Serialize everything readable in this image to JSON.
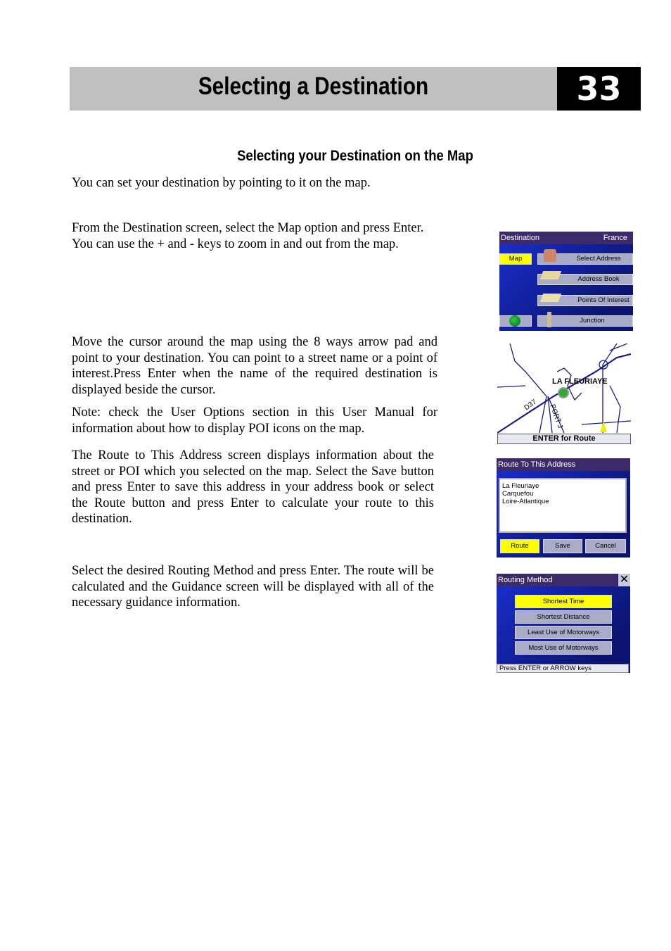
{
  "header": {
    "title": "Selecting a Destination",
    "page_number": "33"
  },
  "section_title": "Selecting your Destination on the Map",
  "paragraphs": [
    "You can set your destination by pointing to it on the map.",
    "From the Destination screen, select the Map option and press Enter. You can use the + and - keys to zoom in and out from the map.",
    "Move the cursor around the map using the 8 ways arrow pad and point to your destination. You can point to a street name or a point of interest.Press Enter when the name of the required destination is displayed beside the cursor.",
    "Note: check the User Options section in this User Manual for information about how to display POI icons on the map.",
    "The Route to This Address screen displays information about the street or POI which you selected on the map. Select the Save button and press Enter to save this address in your address book or select the Route button and press Enter to calculate your route to this destination.",
    "Select the desired Routing Method and press Enter. The route will be calculated and the Guidance screen will be displayed with all of the necessary guidance information."
  ],
  "destination_screen": {
    "title": "Destination",
    "country": "France",
    "map_button": "Map",
    "items": [
      {
        "label": "Select Address",
        "icon": "house-magnifier-icon"
      },
      {
        "label": "Address Book",
        "icon": "book-icon"
      },
      {
        "label": "Points Of Interest",
        "icon": "pin-map-icon"
      },
      {
        "label": "Junction",
        "icon": "signpost-icon"
      }
    ],
    "globe_icon": "globe-icon"
  },
  "map_screen": {
    "place_label": "LA FLEURIAYE",
    "road_labels": [
      "D37",
      "PORT J"
    ],
    "footer": "ENTER for Route"
  },
  "route_screen": {
    "title": "Route To This Address",
    "address_lines": [
      "La Fleuriaye",
      "Carquefou",
      "Loire-Atlantique"
    ],
    "buttons": [
      "Route",
      "Save",
      "Cancel"
    ]
  },
  "routing_screen": {
    "title": "Routing Method",
    "options": [
      "Shortest Time",
      "Shortest Distance",
      "Least Use of Motorways",
      "Most Use of Motorways"
    ],
    "status": "Press ENTER or ARROW keys",
    "close_icon": "close-icon"
  },
  "colors": {
    "title_bar": "#3d2a6b",
    "highlight": "#ffff00",
    "panel": "#1a2fd0",
    "button": "#a8acc8"
  }
}
